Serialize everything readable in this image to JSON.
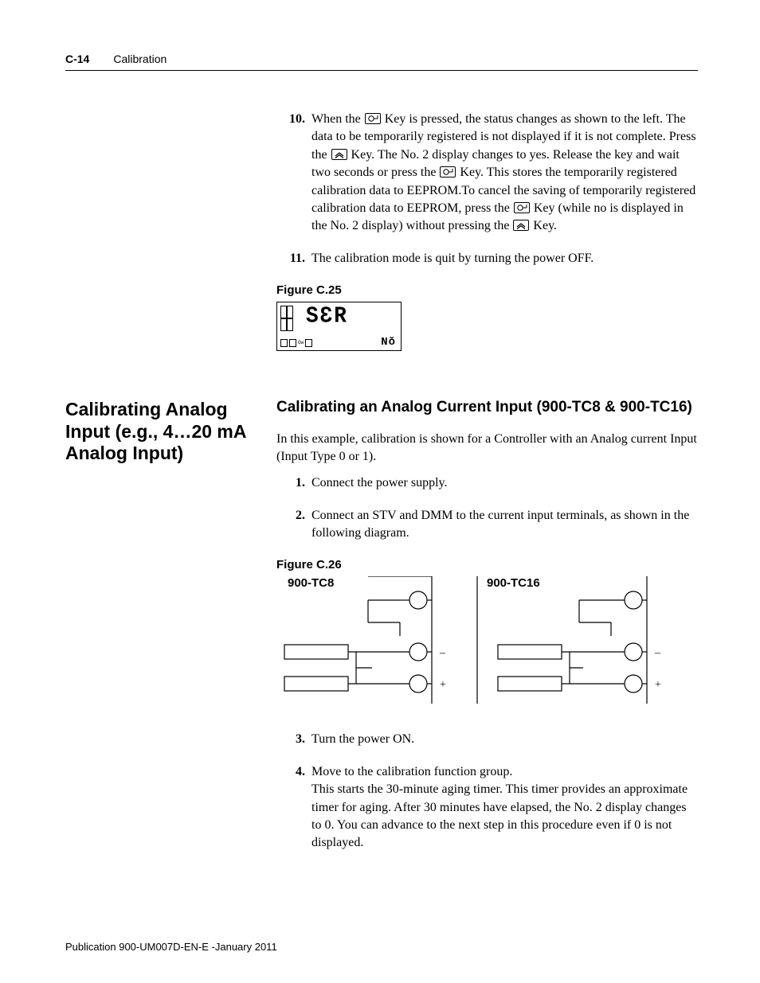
{
  "header": {
    "pageno": "C-14",
    "chapter": "Calibration"
  },
  "steps_a": [
    {
      "num": "10.",
      "parts": [
        "When the ",
        "@enter",
        " Key is pressed, the status changes as shown to the left. The data to be temporarily registered is not displayed if it is not complete. Press the ",
        "@up",
        " Key. The No. 2 display changes to yes. Release the key and wait two seconds or press the ",
        "@enter",
        " Key. This stores the temporarily registered calibration data to EEPROM.To cancel the saving of temporarily registered calibration data to EEPROM, press the ",
        "@enter",
        " Key (while no is displayed in the No. 2 display) without pressing the ",
        "@up",
        " Key."
      ]
    },
    {
      "num": "11.",
      "parts": [
        "The calibration mode is quit by turning the power OFF."
      ]
    }
  ],
  "figure_a_label": "Figure C.25",
  "figure_a_disp_main": "SƐR",
  "figure_a_disp_sub": "Nŏ",
  "left_heading": "Calibrating Analog Input (e.g., 4…20 mA Analog Input)",
  "subheading": "Calibrating an Analog Current Input (900-TC8 & 900-TC16)",
  "intro_p": "In this example, calibration is shown for a Controller with an Analog current Input (Input Type 0 or 1).",
  "steps_b": [
    {
      "num": "1.",
      "text": "Connect the power supply."
    },
    {
      "num": "2.",
      "text": "Connect an STV and DMM to the current input terminals, as shown in the following diagram."
    }
  ],
  "figure_b_label": "Figure C.26",
  "fig26": {
    "left_label": "900-TC8",
    "right_label": "900-TC16",
    "minus": "–",
    "plus": "+"
  },
  "steps_c": [
    {
      "num": "3.",
      "text": "Turn the power ON."
    },
    {
      "num": "4.",
      "text": "Move to the calibration function group.\nThis starts the 30-minute aging timer. This timer provides an approximate timer for aging. After 30 minutes have elapsed, the No. 2 display changes to 0. You can advance to the next step in this procedure even if 0 is not displayed."
    }
  ],
  "pub": "Publication 900-UM007D-EN-E -January 2011"
}
